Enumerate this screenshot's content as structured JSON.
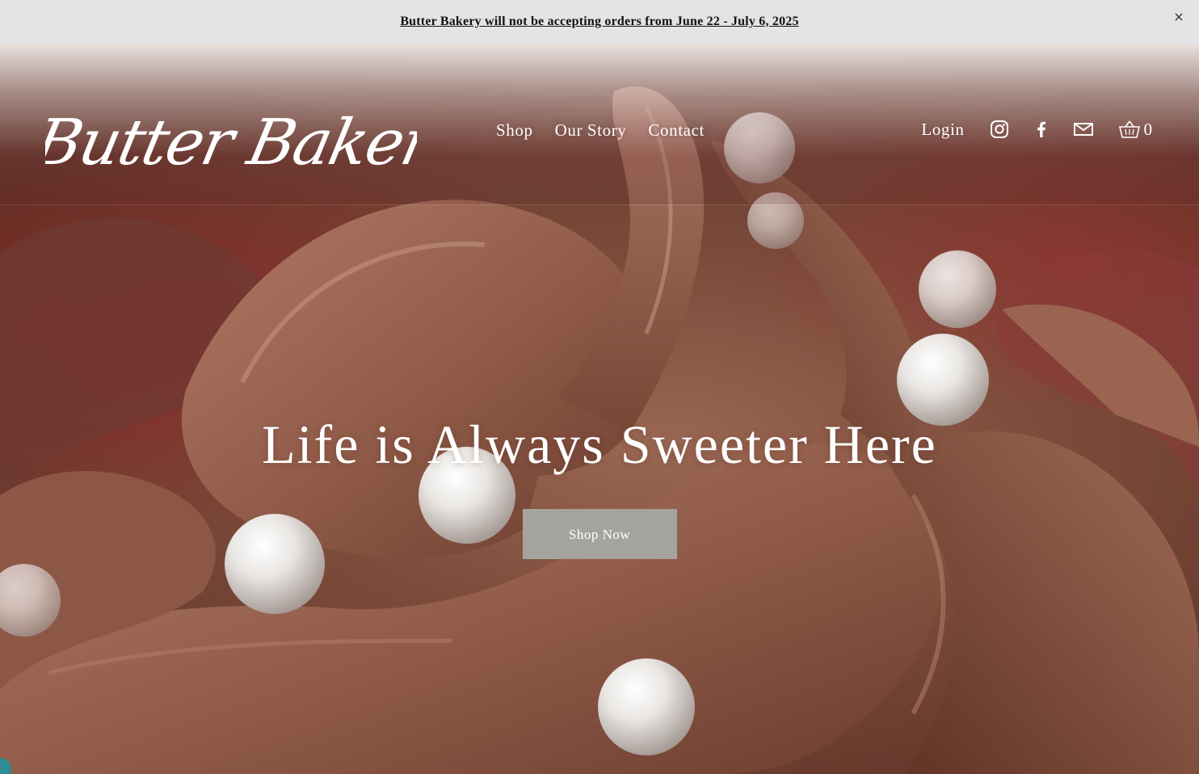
{
  "announcement": {
    "text": "Butter Bakery will not be accepting orders from June 22 - July 6, 2025",
    "close_icon": "close-icon"
  },
  "brand": {
    "logo_text": "Butter Bakery"
  },
  "nav": {
    "items": [
      {
        "label": "Shop"
      },
      {
        "label": "Our Story"
      },
      {
        "label": "Contact"
      }
    ]
  },
  "header_actions": {
    "login_label": "Login",
    "social_icons": [
      "instagram-icon",
      "facebook-icon",
      "email-icon"
    ],
    "cart_icon": "basket-icon",
    "cart_count": "0"
  },
  "hero": {
    "title": "Life is Always Sweeter Here",
    "cta_label": "Shop Now",
    "cta_color": "#a5a39e"
  },
  "colors": {
    "announcement_bg": "#e2e4e6",
    "text_light": "#ffffff",
    "frosting": "#9a6753"
  }
}
